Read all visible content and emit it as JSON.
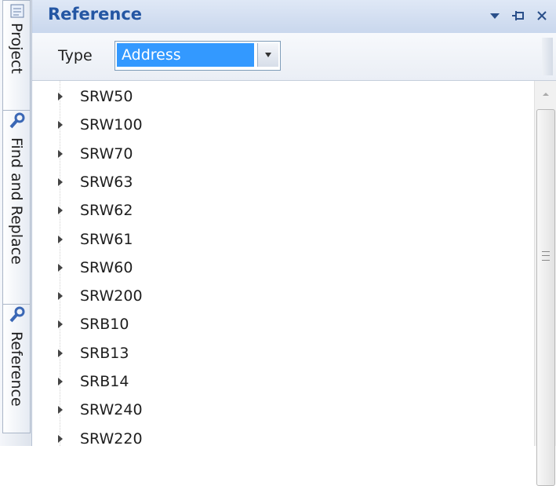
{
  "side_tabs": [
    {
      "label": "Project",
      "icon": "document-icon"
    },
    {
      "label": "Find and Replace",
      "icon": "wrench-icon"
    },
    {
      "label": "Reference",
      "icon": "wrench-icon"
    }
  ],
  "header": {
    "title": "Reference",
    "controls": [
      "dropdown-menu-icon",
      "pin-icon",
      "close-icon"
    ]
  },
  "toolbar": {
    "type_label": "Type",
    "type_value": "Address"
  },
  "tree": {
    "items": [
      "SRW50",
      "SRW100",
      "SRW70",
      "SRW63",
      "SRW62",
      "SRW61",
      "SRW60",
      "SRW200",
      "SRB10",
      "SRB13",
      "SRB14",
      "SRW240",
      "SRW220"
    ]
  },
  "colors": {
    "title": "#2456a3",
    "selection": "#3399ff"
  }
}
